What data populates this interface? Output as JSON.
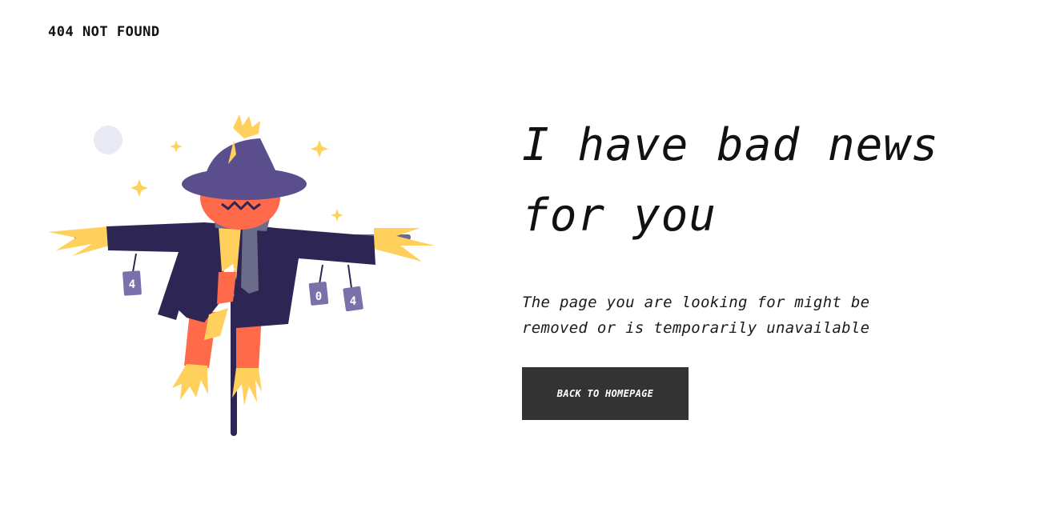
{
  "header": {
    "label": "404 NOT FOUND"
  },
  "hero": {
    "headline": "I have bad news for you",
    "description": "The page you are looking for might be removed or is temporarily unavailable",
    "button_label": "BACK TO HOMEPAGE"
  },
  "illustration": {
    "can_left": "4",
    "can_middle": "0",
    "can_right": "4"
  },
  "colors": {
    "hat": "#5a4e8c",
    "coat": "#2d2654",
    "pumpkin": "#ff6a4a",
    "straw": "#ffd15c",
    "button_bg": "#333333",
    "moon": "#e8eaf4"
  }
}
